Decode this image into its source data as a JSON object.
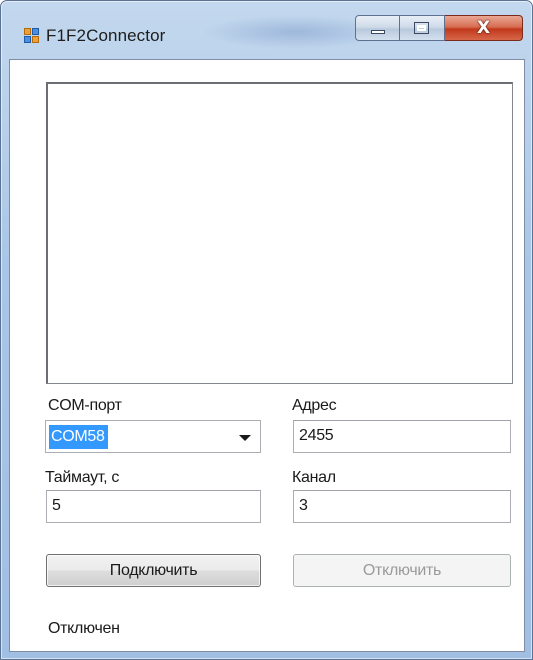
{
  "window": {
    "title": "F1F2Connector",
    "icon": "app-icon",
    "buttons": [
      "minimize-icon",
      "maximize-icon",
      "close-icon"
    ],
    "close_glyph": "X"
  },
  "log": {
    "lines": []
  },
  "form": {
    "com_port": {
      "label": "COM-порт",
      "value": "COM58"
    },
    "address": {
      "label": "Адрес",
      "value": "2455"
    },
    "timeout": {
      "label": "Таймаут, с",
      "value": "5"
    },
    "channel": {
      "label": "Канал",
      "value": "3"
    }
  },
  "buttons": {
    "connect": "Подключить",
    "disconnect": "Отключить",
    "disconnect_enabled": false
  },
  "status": {
    "text": "Отключен"
  },
  "colors": {
    "selection": "#3399ff",
    "close_button": "#c2391c",
    "disabled_text": "#9a9a9a"
  }
}
